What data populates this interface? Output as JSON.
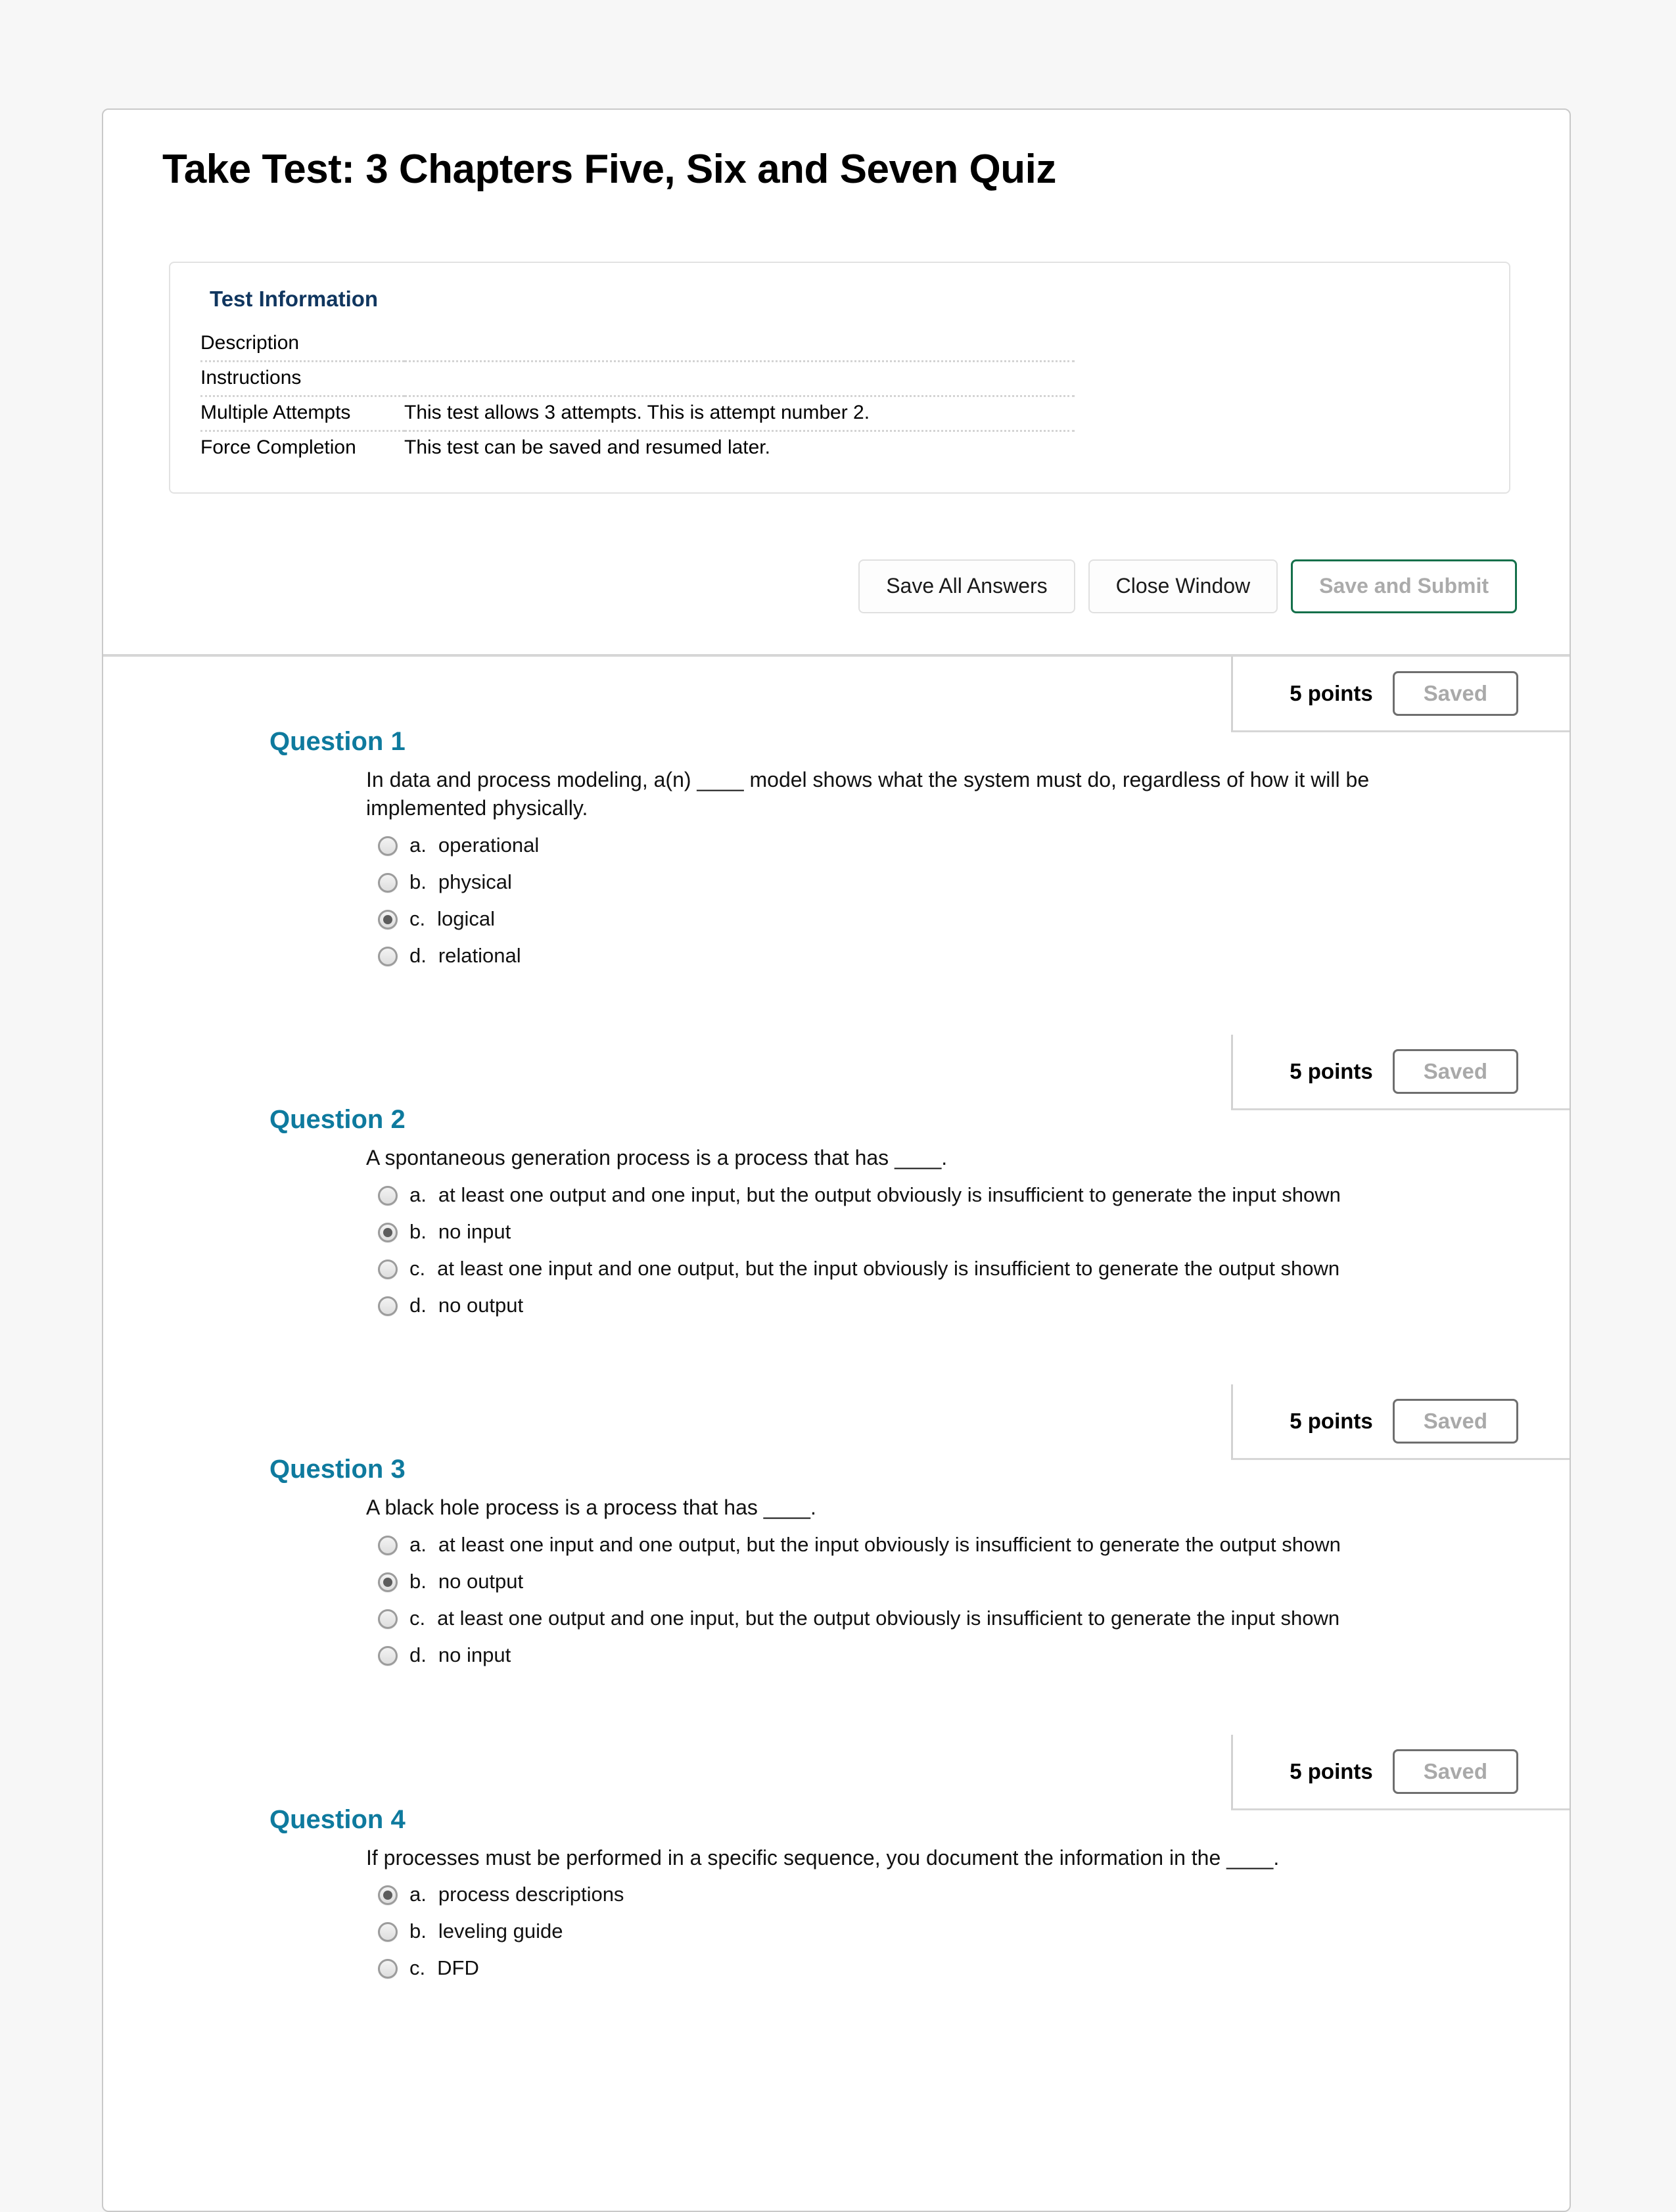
{
  "page": {
    "title": "Take Test: 3 Chapters Five, Six and Seven Quiz"
  },
  "test_information": {
    "heading": "Test Information",
    "rows": [
      {
        "label": "Description",
        "value": ""
      },
      {
        "label": "Instructions",
        "value": ""
      },
      {
        "label": "Multiple Attempts",
        "value": "This test allows 3 attempts. This is attempt number 2."
      },
      {
        "label": "Force Completion",
        "value": "This test can be saved and resumed later."
      }
    ]
  },
  "actions": {
    "save_all_answers": "Save All Answers",
    "close_window": "Close Window",
    "save_and_submit": "Save and Submit"
  },
  "colors": {
    "question_heading": "#0e7a9e",
    "test_info_heading": "#10365f",
    "primary_button_border": "#15704b",
    "saved_text": "#a9a9a9"
  },
  "questions": [
    {
      "heading": "Question 1",
      "points": "5 points",
      "status": "Saved",
      "text": "In data and process modeling, a(n) ____ model shows what the system must do, regardless of how it will be implemented physically.",
      "options": [
        {
          "letter": "a.",
          "text": "operational",
          "selected": false
        },
        {
          "letter": "b.",
          "text": "physical",
          "selected": false
        },
        {
          "letter": "c.",
          "text": "logical",
          "selected": true
        },
        {
          "letter": "d.",
          "text": "relational",
          "selected": false
        }
      ]
    },
    {
      "heading": "Question 2",
      "points": "5 points",
      "status": "Saved",
      "text": "A spontaneous generation process is a process that has ____.",
      "options": [
        {
          "letter": "a.",
          "text": "at least one output and one input, but the output obviously is insufficient to generate the input shown",
          "selected": false
        },
        {
          "letter": "b.",
          "text": "no input",
          "selected": true
        },
        {
          "letter": "c.",
          "text": "at least one input and one output, but the input obviously is insufficient to generate the output shown",
          "selected": false
        },
        {
          "letter": "d.",
          "text": "no output",
          "selected": false
        }
      ]
    },
    {
      "heading": "Question 3",
      "points": "5 points",
      "status": "Saved",
      "text": "A black hole process is a process that has ____.",
      "options": [
        {
          "letter": "a.",
          "text": "at least one input and one output, but the input obviously is insufficient to generate the output shown",
          "selected": false
        },
        {
          "letter": "b.",
          "text": "no output",
          "selected": true
        },
        {
          "letter": "c.",
          "text": "at least one output and one input, but the output obviously is insufficient to generate the input shown",
          "selected": false
        },
        {
          "letter": "d.",
          "text": "no input",
          "selected": false
        }
      ]
    },
    {
      "heading": "Question 4",
      "points": "5 points",
      "status": "Saved",
      "text": "If processes must be performed in a specific sequence, you document the information in the ____.",
      "options": [
        {
          "letter": "a.",
          "text": "process descriptions",
          "selected": true
        },
        {
          "letter": "b.",
          "text": "leveling guide",
          "selected": false
        },
        {
          "letter": "c.",
          "text": "DFD",
          "selected": false
        }
      ]
    }
  ]
}
